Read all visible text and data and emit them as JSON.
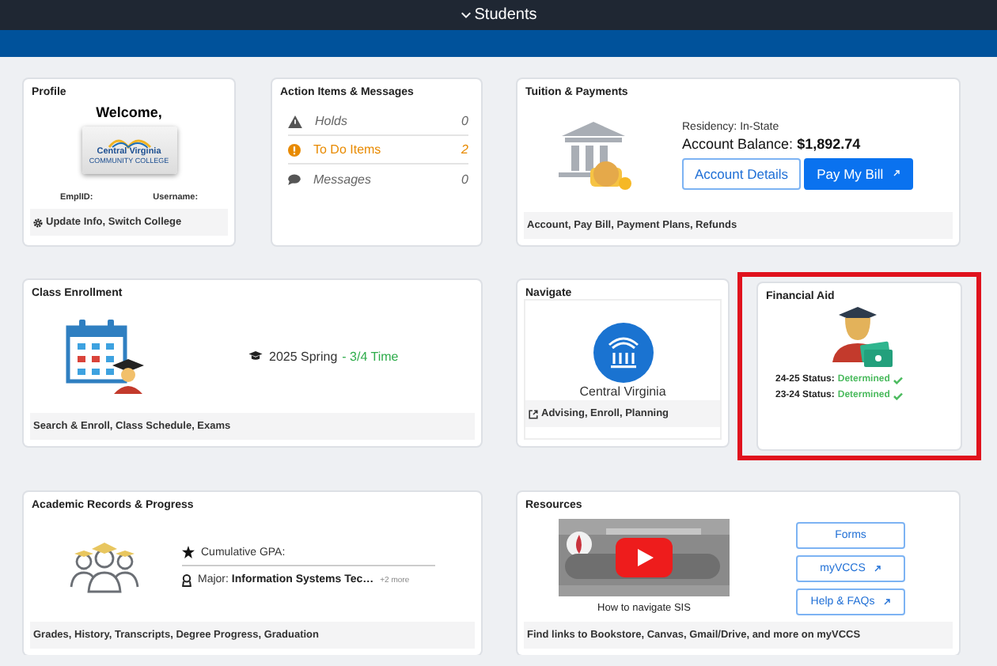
{
  "header": {
    "title": "Students"
  },
  "profile": {
    "title": "Profile",
    "welcome": "Welcome,",
    "logo": {
      "name": "Central Virginia",
      "subtitle": "COMMUNITY COLLEGE"
    },
    "emplid_label": "EmplID:",
    "username_label": "Username:",
    "footer": "Update Info, Switch College"
  },
  "action_items": {
    "title": "Action Items & Messages",
    "items": [
      {
        "kind": "warning",
        "label": "Holds",
        "count": "0",
        "highlighted": false
      },
      {
        "kind": "alert",
        "label": "To Do Items",
        "count": "2",
        "highlighted": true
      },
      {
        "kind": "message",
        "label": "Messages",
        "count": "0",
        "highlighted": false
      }
    ]
  },
  "tuition": {
    "title": "Tuition & Payments",
    "residency": "Residency: In-State",
    "balance_label": "Account Balance:",
    "balance": "$1,892.74",
    "buttons": [
      {
        "label": "Account Details",
        "primary": false,
        "external": false
      },
      {
        "label": "Pay My Bill",
        "primary": true,
        "external": true
      }
    ],
    "footer": "Account, Pay Bill, Payment Plans, Refunds"
  },
  "enrollment": {
    "title": "Class Enrollment",
    "term": "2025 Spring",
    "load": "- 3/4 Time",
    "footer": "Search & Enroll, Class Schedule, Exams"
  },
  "navigate": {
    "title": "Navigate",
    "caption": "Central Virginia",
    "footer": "Advising, Enroll, Planning"
  },
  "financial_aid": {
    "title": "Financial Aid",
    "highlighted": true,
    "statuses": [
      {
        "label": "24-25 Status:",
        "value": "Determined"
      },
      {
        "label": "23-24 Status:",
        "value": "Determined"
      }
    ]
  },
  "academic": {
    "title": "Academic Records & Progress",
    "gpa_label": "Cumulative GPA:",
    "major_label": "Major:",
    "major": "Information Systems Tec…",
    "more": "+2 more",
    "footer": "Grades, History, Transcripts, Degree Progress, Graduation"
  },
  "resources": {
    "title": "Resources",
    "video_caption": "How to navigate SIS",
    "buttons": [
      {
        "label": "Forms",
        "external": false
      },
      {
        "label": "myVCCS",
        "external": true
      },
      {
        "label": "Help & FAQs",
        "external": true
      }
    ],
    "footer": "Find links to Bookstore, Canvas, Gmail/Drive, and more on myVCCS"
  }
}
